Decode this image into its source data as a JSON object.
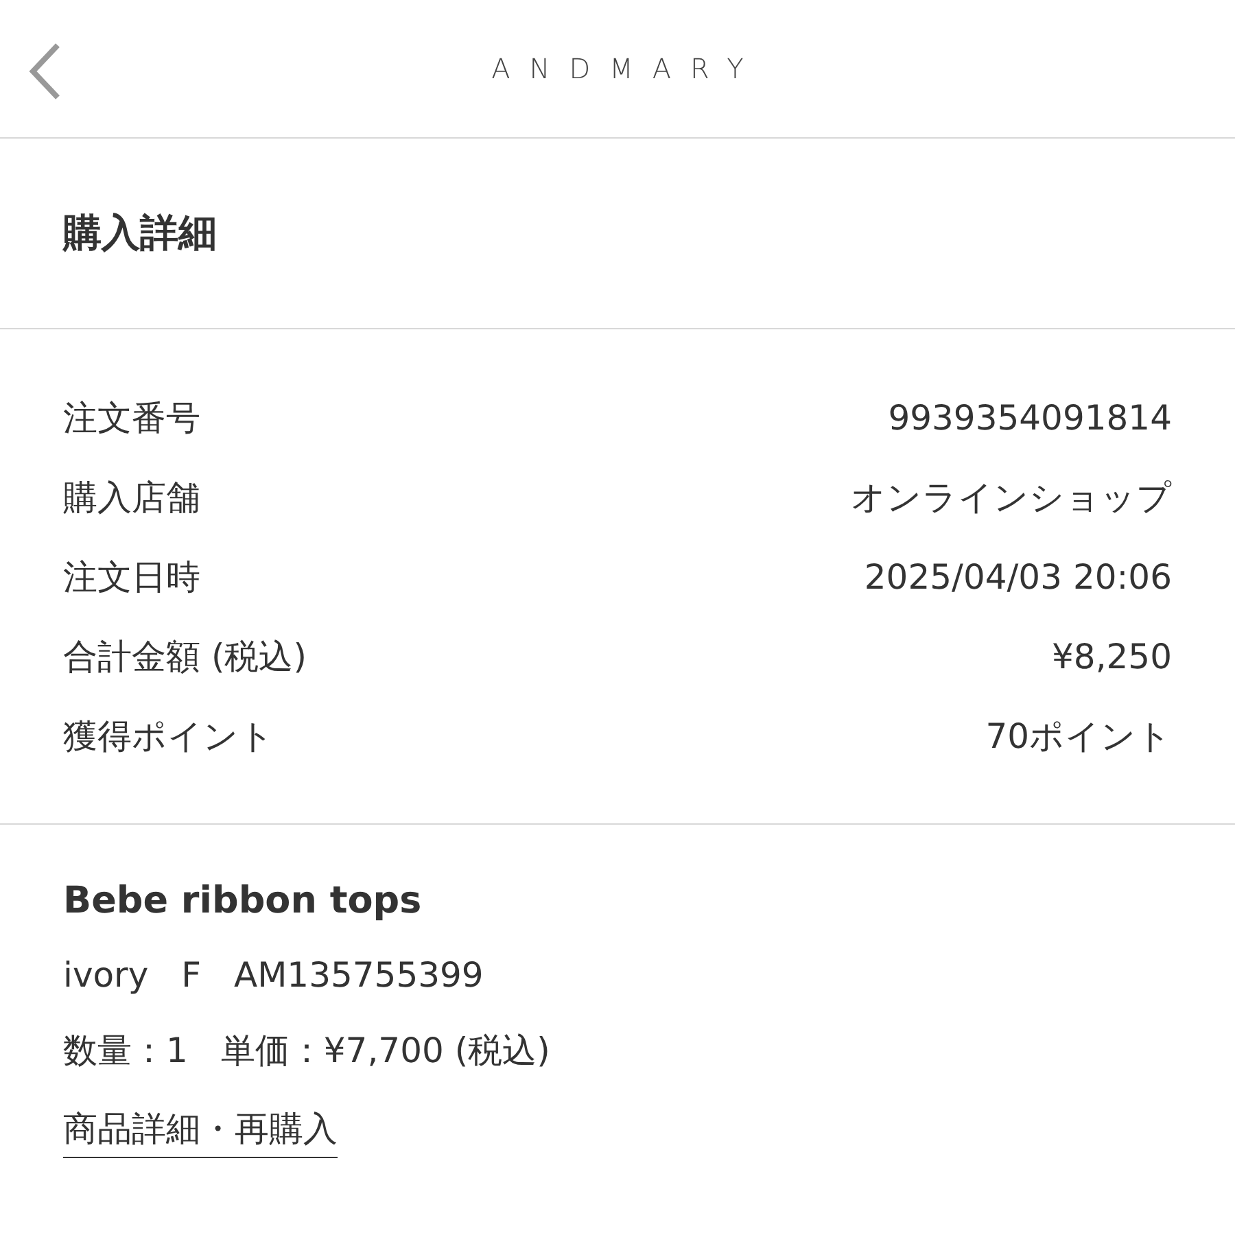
{
  "header": {
    "logo": "ANDMARY"
  },
  "title": "購入詳細",
  "details": [
    {
      "label": "注文番号",
      "value": "9939354091814"
    },
    {
      "label": "購入店舗",
      "value": "オンラインショップ"
    },
    {
      "label": "注文日時",
      "value": "2025/04/03 20:06"
    },
    {
      "label": "合計金額 (税込)",
      "value": "¥8,250"
    },
    {
      "label": "獲得ポイント",
      "value": "70ポイント"
    }
  ],
  "product": {
    "name": "Bebe ribbon tops",
    "specs": [
      "ivory",
      "F",
      "AM135755399"
    ],
    "price_parts": [
      "数量：1",
      "単価：¥7,700 (税込)"
    ],
    "link": "商品詳細・再購入"
  }
}
